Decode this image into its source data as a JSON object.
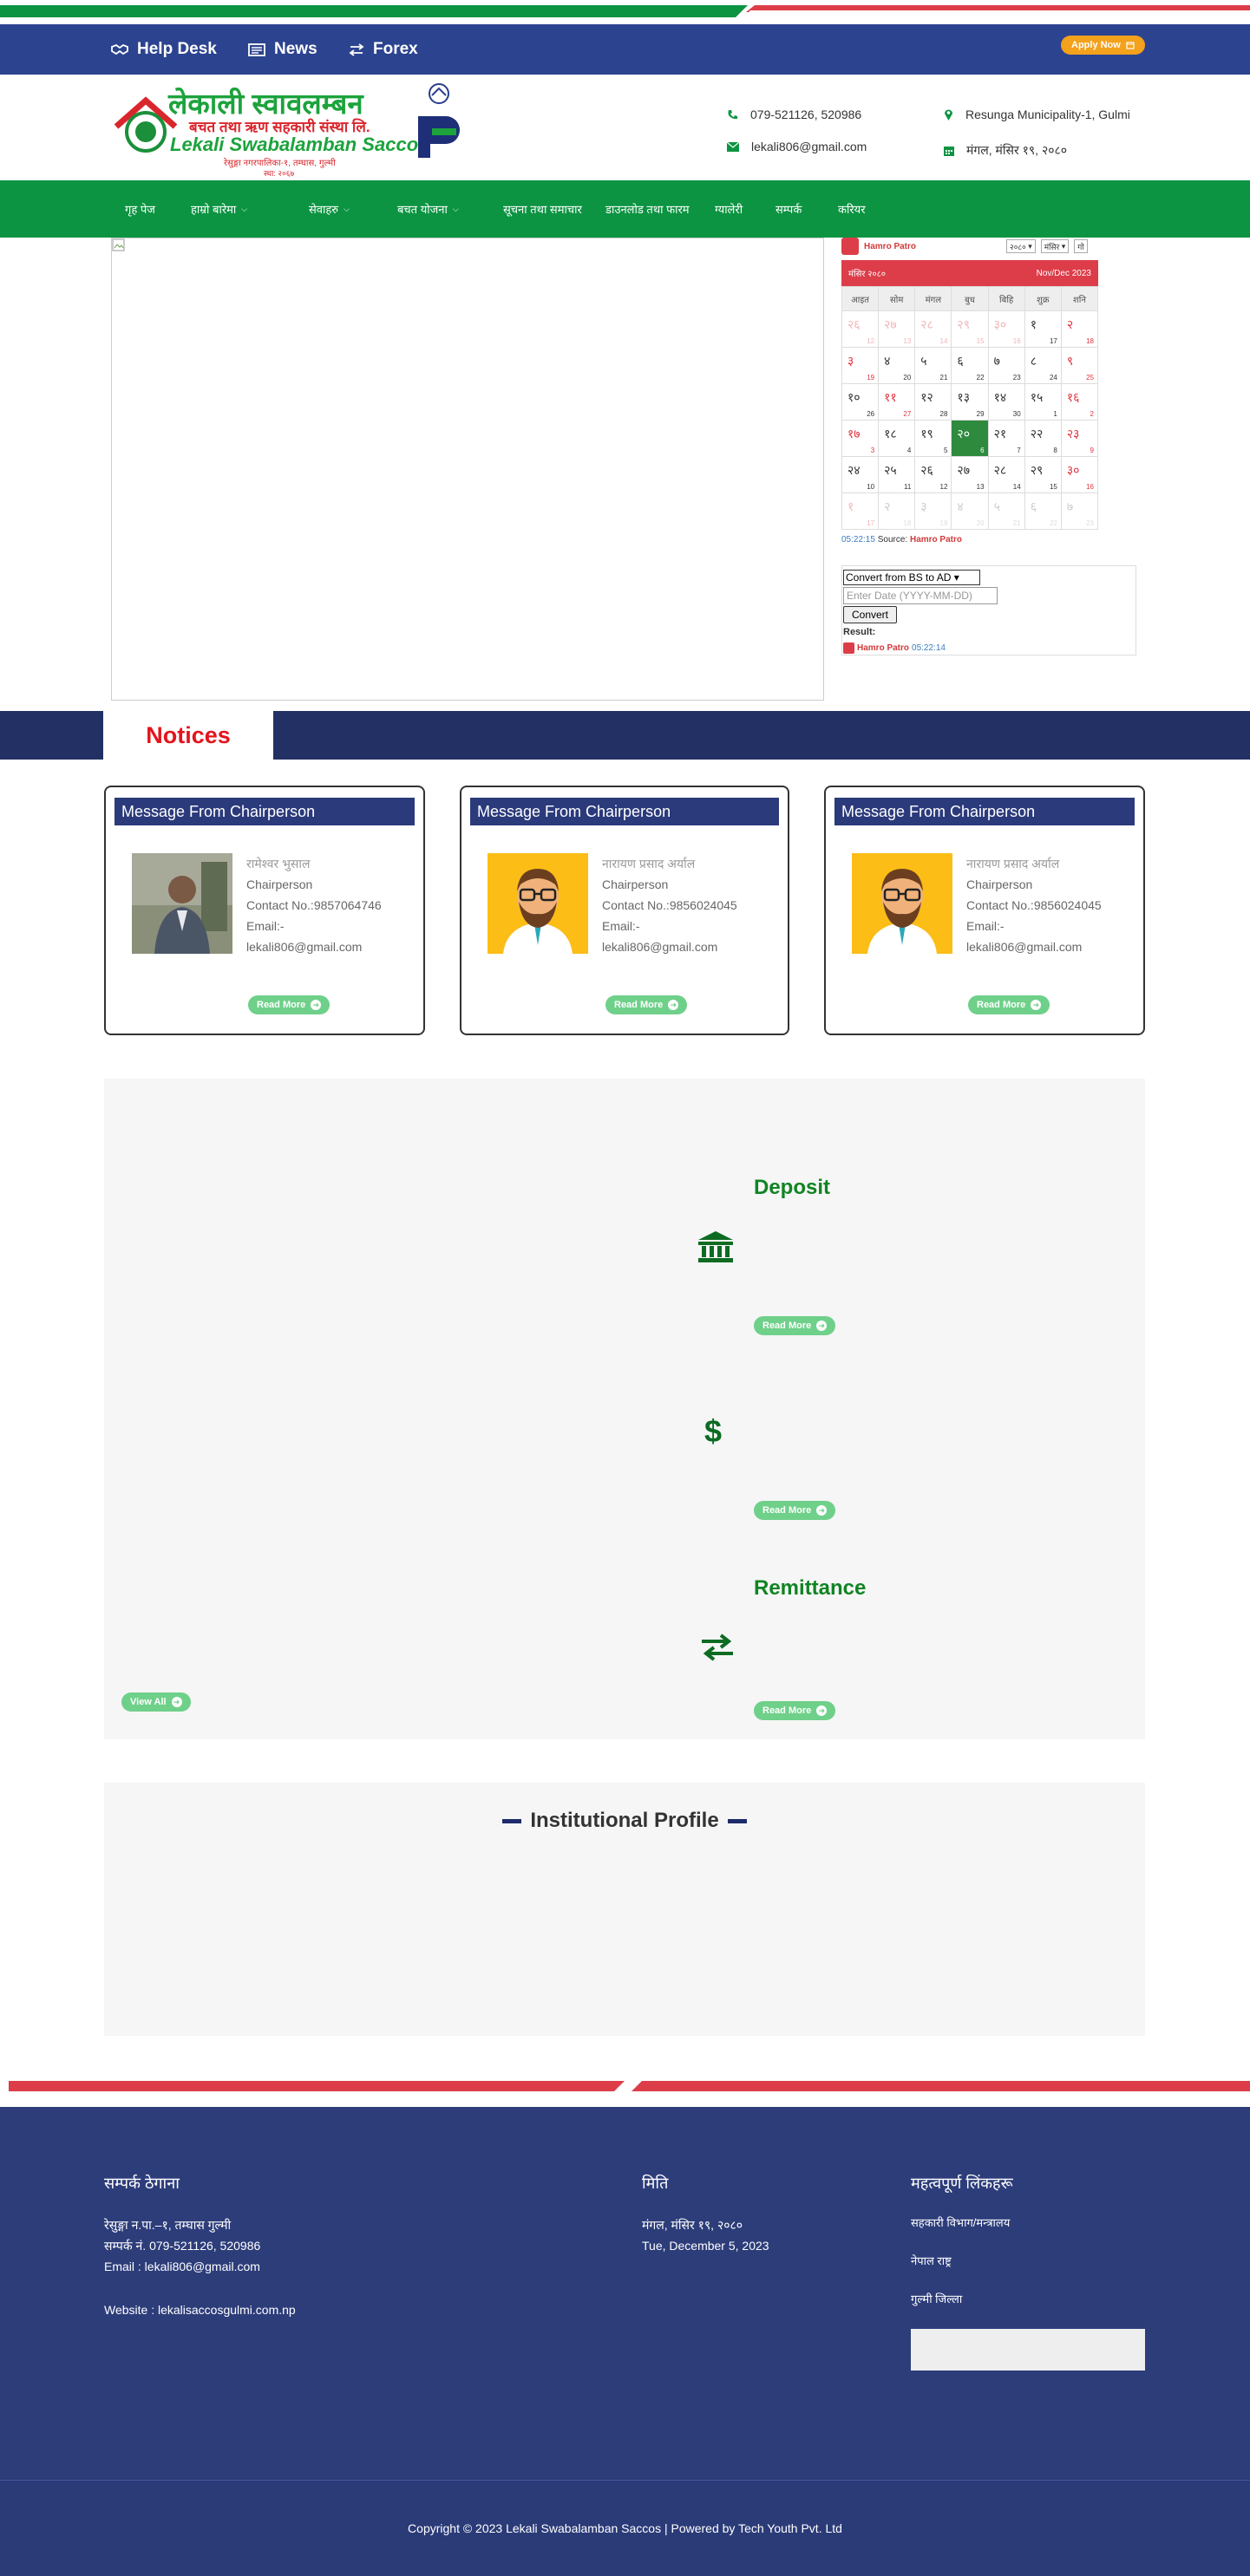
{
  "topbar": {
    "help_desk": "Help Desk",
    "news": "News",
    "forex": "Forex",
    "apply_now": "Apply Now"
  },
  "header": {
    "logo_nepali": "लेकाली स्वावलम्बन",
    "logo_sub_nepali": "बचत तथा ऋण सहकारी संस्था लि.",
    "logo_english": "Lekali Swabalamban Saccos",
    "logo_address_nepali": "रेसुङ्गा नगरपालिका-१, तम्घास, गुल्मी",
    "logo_est": "स्था: २०६७",
    "phone": "079-521126, 520986",
    "email": "lekali806@gmail.com",
    "address": "Resunga Municipality-1, Gulmi",
    "date_nepali": "मंगल, मंसिर १९, २०८०"
  },
  "nav": {
    "items": [
      {
        "label": "गृह पेज",
        "has_dropdown": false
      },
      {
        "label": "हाम्रो बारेमा",
        "has_dropdown": true
      },
      {
        "label": "सेवाहरु",
        "has_dropdown": true
      },
      {
        "label": "बचत योजना",
        "has_dropdown": true
      },
      {
        "label": "सूचना तथा समाचार",
        "has_dropdown": false
      },
      {
        "label": "डाउनलोड तथा फारम",
        "has_dropdown": false
      },
      {
        "label": "ग्यालेरी",
        "has_dropdown": false
      },
      {
        "label": "सम्पर्क",
        "has_dropdown": false
      },
      {
        "label": "करियर",
        "has_dropdown": false
      }
    ]
  },
  "calendar": {
    "brand": "Hamro Patro",
    "year_select": "२०८०",
    "month_select": "मंसिर",
    "go": "गो",
    "month_title": "मंसिर २०८०",
    "english_month": "Nov/Dec 2023",
    "weekdays": [
      "आइत",
      "सोम",
      "मंगल",
      "बुध",
      "बिहि",
      "शुक्र",
      "शनि"
    ],
    "days": [
      {
        "np": "२६",
        "en": "12",
        "off": true,
        "sat": true
      },
      {
        "np": "२७",
        "en": "13",
        "off": true,
        "sat": true
      },
      {
        "np": "२८",
        "en": "14",
        "off": true,
        "sat": true
      },
      {
        "np": "२९",
        "en": "15",
        "off": true,
        "sat": true
      },
      {
        "np": "३०",
        "en": "16",
        "off": true,
        "sat": true
      },
      {
        "np": "१",
        "en": "17",
        "off": false,
        "sat": false
      },
      {
        "np": "२",
        "en": "18",
        "off": false,
        "sat": true
      },
      {
        "np": "३",
        "en": "19",
        "off": false,
        "sat": true
      },
      {
        "np": "४",
        "en": "20",
        "off": false,
        "sat": false
      },
      {
        "np": "५",
        "en": "21",
        "off": false,
        "sat": false
      },
      {
        "np": "६",
        "en": "22",
        "off": false,
        "sat": false
      },
      {
        "np": "७",
        "en": "23",
        "off": false,
        "sat": false
      },
      {
        "np": "८",
        "en": "24",
        "off": false,
        "sat": false
      },
      {
        "np": "९",
        "en": "25",
        "off": false,
        "sat": true
      },
      {
        "np": "१०",
        "en": "26",
        "off": false,
        "sat": false
      },
      {
        "np": "११",
        "en": "27",
        "off": false,
        "sat": true
      },
      {
        "np": "१२",
        "en": "28",
        "off": false,
        "sat": false
      },
      {
        "np": "१३",
        "en": "29",
        "off": false,
        "sat": false
      },
      {
        "np": "१४",
        "en": "30",
        "off": false,
        "sat": false
      },
      {
        "np": "१५",
        "en": "1",
        "off": false,
        "sat": false
      },
      {
        "np": "१६",
        "en": "2",
        "off": false,
        "sat": true
      },
      {
        "np": "१७",
        "en": "3",
        "off": false,
        "sat": true
      },
      {
        "np": "१८",
        "en": "4",
        "off": false,
        "sat": false
      },
      {
        "np": "१९",
        "en": "5",
        "off": false,
        "sat": false
      },
      {
        "np": "२०",
        "en": "6",
        "off": false,
        "sat": false,
        "today": true
      },
      {
        "np": "२१",
        "en": "7",
        "off": false,
        "sat": false
      },
      {
        "np": "२२",
        "en": "8",
        "off": false,
        "sat": false
      },
      {
        "np": "२३",
        "en": "9",
        "off": false,
        "sat": true
      },
      {
        "np": "२४",
        "en": "10",
        "off": false,
        "sat": false
      },
      {
        "np": "२५",
        "en": "11",
        "off": false,
        "sat": false
      },
      {
        "np": "२६",
        "en": "12",
        "off": false,
        "sat": false
      },
      {
        "np": "२७",
        "en": "13",
        "off": false,
        "sat": false
      },
      {
        "np": "२८",
        "en": "14",
        "off": false,
        "sat": false
      },
      {
        "np": "२९",
        "en": "15",
        "off": false,
        "sat": false
      },
      {
        "np": "३०",
        "en": "16",
        "off": false,
        "sat": true
      },
      {
        "np": "१",
        "en": "17",
        "off": true,
        "sat": true
      },
      {
        "np": "२",
        "en": "18",
        "off": true,
        "sat": false
      },
      {
        "np": "३",
        "en": "19",
        "off": true,
        "sat": false
      },
      {
        "np": "४",
        "en": "20",
        "off": true,
        "sat": false
      },
      {
        "np": "५",
        "en": "21",
        "off": true,
        "sat": false
      },
      {
        "np": "६",
        "en": "22",
        "off": true,
        "sat": false
      },
      {
        "np": "७",
        "en": "23",
        "off": true,
        "sat": false
      }
    ],
    "time": "05:22:15",
    "source_label": "Source:",
    "source": "Hamro Patro"
  },
  "converter": {
    "mode": "Convert from BS to AD",
    "placeholder": "Enter Date (YYYY-MM-DD)",
    "button": "Convert",
    "result_label": "Result:",
    "brand": "Hamro Patro",
    "time": "05:22:14"
  },
  "notices": {
    "title": "Notices",
    "read_more": "Read More",
    "cards": [
      {
        "title": "Message From Chairperson",
        "name": "रामेश्वर भुसाल",
        "role": "Chairperson",
        "contact": "Contact No.:9857064746",
        "email_label": "Email:-",
        "email": "lekali806@gmail.com"
      },
      {
        "title": "Message From Chairperson",
        "name": "नारायण प्रसाद अर्याल",
        "role": "Chairperson",
        "contact": "Contact No.:9856024045",
        "email_label": "Email:-",
        "email": "lekali806@gmail.com"
      },
      {
        "title": "Message From Chairperson",
        "name": "नारायण प्रसाद अर्याल",
        "role": "Chairperson",
        "contact": "Contact No.:9856024045",
        "email_label": "Email:-",
        "email": "lekali806@gmail.com"
      }
    ]
  },
  "services": {
    "deposit_title": "Deposit",
    "remittance_title": "Remittance",
    "read_more": "Read More",
    "view_all": "View All"
  },
  "institutional": {
    "title": "Institutional Profile"
  },
  "footer": {
    "col1_title": "सम्पर्क ठेगाना",
    "col1_line1": "रेसुङ्गा न.पा.–१, तम्घास गुल्मी",
    "col1_line2": "सम्पर्क नं. 079-521126, 520986",
    "col1_email": "Email : lekali806@gmail.com",
    "col1_website": "Website : lekalisaccosgulmi.com.np",
    "col2_title": "मिति",
    "col2_nepali_date": "मंगल, मंसिर १९, २०८०",
    "col2_english_date": "Tue, December 5, 2023",
    "col3_title": "महत्वपूर्ण लिंकहरू",
    "col3_links": [
      "सहकारी विभाग/मन्त्रालय",
      "नेपाल राष्ट्र",
      "गुल्मी जिल्ला"
    ],
    "copyright": "Copyright © 2023 Lekali Swabalamban Saccos | Powered by Tech Youth Pvt. Ltd"
  },
  "colors": {
    "blue": "#2c4390",
    "green": "#0c9442",
    "red": "#dc3d49",
    "orange": "#f4a11c",
    "footer": "#2d3d7a"
  }
}
